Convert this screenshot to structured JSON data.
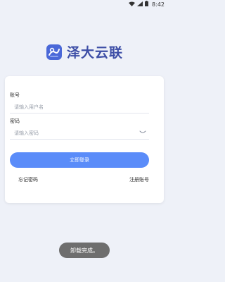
{
  "status_bar": {
    "time": "8:42",
    "icons": [
      "wifi-icon",
      "signal-icon",
      "battery-icon"
    ]
  },
  "brand": {
    "name": "泽大云联",
    "logo_icon": "zeda-logo-icon",
    "color": "#3d4ea6"
  },
  "login_form": {
    "account_label": "账号",
    "account_placeholder": "请输入用户名",
    "password_label": "密码",
    "password_placeholder": "请输入密码",
    "password_toggle_icon": "eye-closed-icon",
    "login_button": "立即登录",
    "forgot_password": "忘记密码",
    "register": "注册账号",
    "accent_color": "#5a8cf9"
  },
  "toast": {
    "message": "卸载完成。"
  }
}
